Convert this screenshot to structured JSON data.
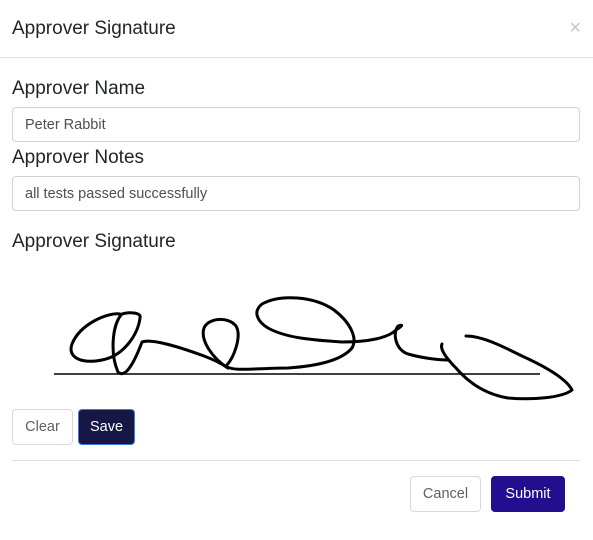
{
  "modal": {
    "title": "Approver Signature",
    "close_icon": "close-icon"
  },
  "form": {
    "name_label": "Approver Name",
    "name_value": "Peter Rabbit",
    "notes_label": "Approver Notes",
    "notes_value": "all tests passed successfully",
    "signature_label": "Approver Signature"
  },
  "signature_pad": {
    "clear_label": "Clear",
    "save_label": "Save"
  },
  "footer": {
    "cancel_label": "Cancel",
    "submit_label": "Submit"
  },
  "colors": {
    "save_button": "#171746",
    "submit_button": "#230e8f",
    "ink": "#000000"
  }
}
